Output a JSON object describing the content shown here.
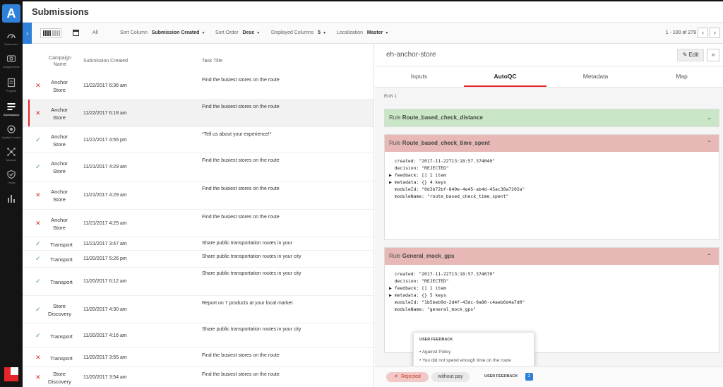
{
  "app": {
    "logo_letter": "A",
    "page_title": "Submissions"
  },
  "nav": [
    {
      "label": "Dashboard",
      "icon": "dashboard-icon"
    },
    {
      "label": "Assignments",
      "icon": "assignments-icon"
    },
    {
      "label": "Projects",
      "icon": "projects-icon"
    },
    {
      "label": "Submissions",
      "icon": "submissions-icon",
      "active": true
    },
    {
      "label": "Quality Control",
      "icon": "quality-icon"
    },
    {
      "label": "Network",
      "icon": "network-icon"
    },
    {
      "label": "Trusts",
      "icon": "trust-icon"
    },
    {
      "label": "",
      "icon": "analytics-icon"
    }
  ],
  "toolbar": {
    "all_label": "All",
    "sort_column_label": "Sort Column",
    "sort_column_value": "Submission Created",
    "sort_order_label": "Sort Order",
    "sort_order_value": "Desc",
    "displayed_columns_label": "Displayed Columns",
    "displayed_columns_value": "5",
    "localization_label": "Localization",
    "localization_value": "Master",
    "pager": "1 - 100 of 279",
    "prev": "‹",
    "next": "›"
  },
  "table": {
    "headers": {
      "campaign": "Campaign\nName",
      "created": "Submission Created",
      "task": "Task Title"
    },
    "rows": [
      {
        "status": "rejected",
        "campaign": "Anchor Store",
        "created": "11/22/2017 6:36 am",
        "task": "Find the busiest stores on the route"
      },
      {
        "status": "rejected",
        "campaign": "Anchor Store",
        "created": "11/22/2017 6:18 am",
        "task": "Find the busiest stores on the route",
        "selected": true
      },
      {
        "status": "approved",
        "campaign": "Anchor Store",
        "created": "11/21/2017 4:55 pm",
        "task": "*Tell us about your experience!*"
      },
      {
        "status": "approved",
        "campaign": "Anchor Store",
        "created": "11/21/2017 4:29 am",
        "task": "Find the busiest stores on the route"
      },
      {
        "status": "rejected",
        "campaign": "Anchor Store",
        "created": "11/21/2017 4:29 am",
        "task": "Find the busiest stores on the route"
      },
      {
        "status": "rejected",
        "campaign": "Anchor Store",
        "created": "11/21/2017 4:25 am",
        "task": "Find the busiest stores on the route"
      },
      {
        "status": "approved",
        "campaign": "Transport",
        "created": "11/21/2017 3:47 am",
        "task": "Share public transportation routes in your"
      },
      {
        "status": "approved",
        "campaign": "Transport",
        "created": "11/20/2017 5:26 pm",
        "task": "Share public transportation routes in your city"
      },
      {
        "status": "approved",
        "campaign": "Transport",
        "created": "11/20/2017 6:12 am",
        "task": "Share public transportation routes in your city"
      },
      {
        "status": "approved",
        "campaign": "Store Discovery",
        "created": "11/20/2017 4:30 am",
        "task": "Report on 7 products at your local market"
      },
      {
        "status": "approved",
        "campaign": "Transport",
        "created": "11/20/2017 4:16 am",
        "task": "Share public transportation routes in your city"
      },
      {
        "status": "rejected",
        "campaign": "Transport",
        "created": "11/20/2017 3:55 am",
        "task": "Find the busiest stores on the route"
      },
      {
        "status": "rejected",
        "campaign": "Store Discovery",
        "created": "11/20/2017 3:54 am",
        "task": "Find the busiest stores on the route"
      }
    ]
  },
  "detail": {
    "title": "eh-anchor-store",
    "edit_label": "Edit",
    "expand_label": "»",
    "tabs": [
      "Inputs",
      "AutoQC",
      "Metadata",
      "Map"
    ],
    "run_label": "RUN 1",
    "rules": [
      {
        "prefix": "Rule",
        "name": "Route_based_check_distance",
        "result": "pass",
        "expanded": false,
        "code": ""
      },
      {
        "prefix": "Rule",
        "name": "Route_based_check_time_spent",
        "result": "fail",
        "expanded": true,
        "code": "  created: \"2017-11-22T13:18:57.374040\"\n  decision: \"REJECTED\"\n▶ feedback: [] 1 item\n▶ metadata: {} 4 keys\n  moduleId: \"0d3b72bf-849e-4e45-ab4d-45ac38a7202a\"\n  moduleName: \"route_based_check_time_spent\""
      },
      {
        "prefix": "Rule",
        "name": "General_mock_gps",
        "result": "fail",
        "expanded": true,
        "code": "  created: \"2017-11-22T13:18:57.374070\"\n  decision: \"REJECTED\"\n▶ feedback: [] 1 item\n▶ metadata: {} 5 keys\n  moduleId: \"1b5beb9d-2d4f-43dc-9a80-c4aeb6d4a7d0\"\n  moduleName: \"general_mock_gps\""
      }
    ],
    "feedback_popup": {
      "heading": "USER FEEDBACK",
      "items": [
        "• Against Policy",
        "• You did not spend enough time on the route"
      ]
    },
    "footer": {
      "rejected_chip": "Rejected",
      "pay_chip": "without pay",
      "feedback_label": "USER FEEDBACK",
      "feedback_count": "2"
    }
  },
  "colors": {
    "accent_blue": "#2f80d8",
    "reject_red": "#d9342b",
    "approve_green": "#43a047",
    "pass_bg": "#c9e7c6",
    "fail_bg": "#e7b8b6"
  }
}
